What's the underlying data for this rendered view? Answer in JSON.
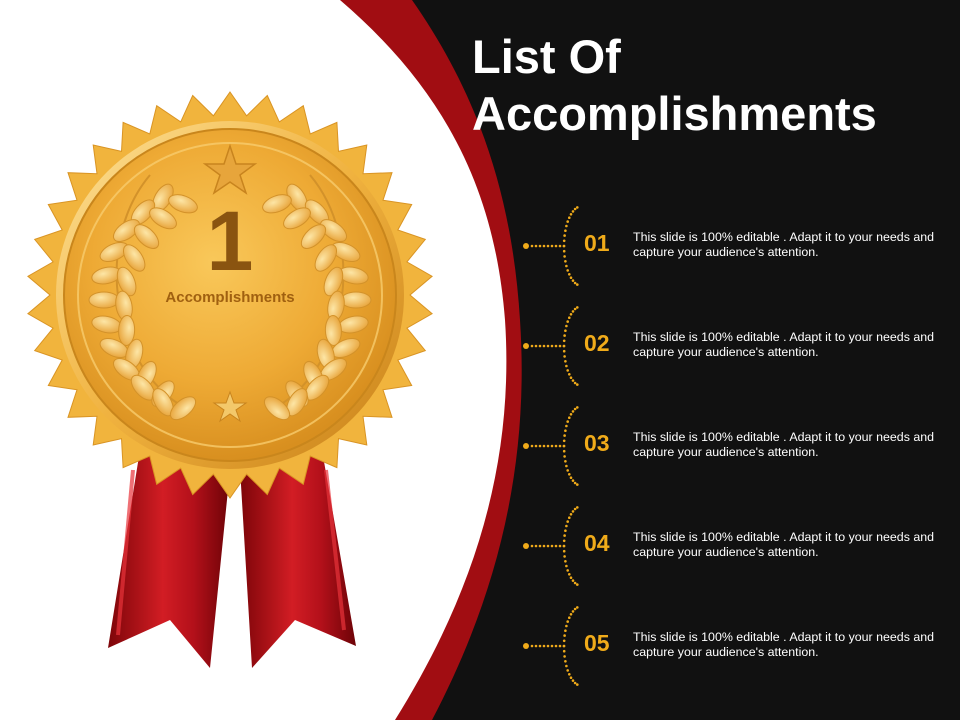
{
  "title": {
    "line1": "List Of",
    "line2": "Accomplishments"
  },
  "medal": {
    "number": "1",
    "label": "Accomplishments"
  },
  "items": [
    {
      "number": "01",
      "text": "This slide is 100% editable . Adapt it to your needs and capture your audience's attention."
    },
    {
      "number": "02",
      "text": "This slide is 100% editable . Adapt it to your needs and capture your audience's attention."
    },
    {
      "number": "03",
      "text": "This slide is 100% editable . Adapt it to your needs and capture your audience's attention."
    },
    {
      "number": "04",
      "text": "This slide is 100% editable . Adapt it to your needs and capture your audience's attention."
    },
    {
      "number": "05",
      "text": "This slide is 100% editable . Adapt it to your needs and capture your audience's attention."
    }
  ],
  "colors": {
    "background": "#111111",
    "accent_red": "#a10d12",
    "gold": "#f0ab1a",
    "text": "#ffffff"
  },
  "icons": [
    "gold-medal-icon",
    "star-icon",
    "laurel-wreath-icon",
    "red-ribbon-icon"
  ]
}
